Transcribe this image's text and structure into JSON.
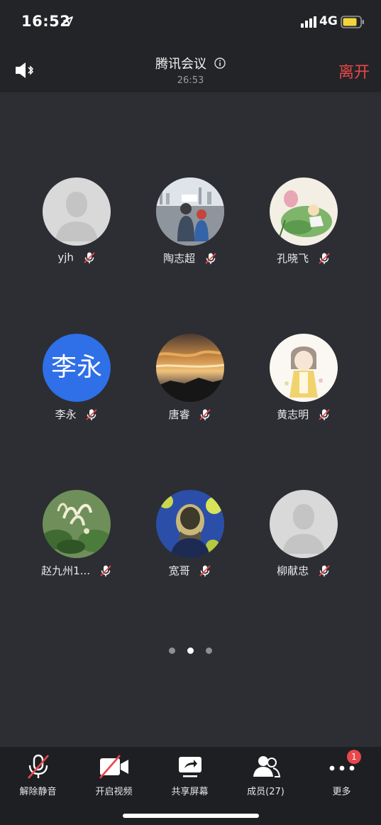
{
  "status_bar": {
    "time": "16:52",
    "network": "4G"
  },
  "header": {
    "title": "腾讯会议",
    "duration": "26:53",
    "leave_label": "离开"
  },
  "participants": [
    {
      "name": "yjh",
      "avatar": "default-person"
    },
    {
      "name": "陶志超",
      "avatar": "photo-two-kids"
    },
    {
      "name": "孔晓飞",
      "avatar": "painting-lotus"
    },
    {
      "name": "李永",
      "avatar": "text",
      "avatar_text": "李永"
    },
    {
      "name": "唐睿",
      "avatar": "photo-sunset-sky"
    },
    {
      "name": "黄志明",
      "avatar": "illustration-girl"
    },
    {
      "name": "赵九州1...",
      "avatar": "photo-flowers"
    },
    {
      "name": "宽哥",
      "avatar": "photo-portrait-blue"
    },
    {
      "name": "柳献忠",
      "avatar": "default-person"
    }
  ],
  "pagination": {
    "pages": 3,
    "active": 2
  },
  "toolbar": {
    "unmute": "解除静音",
    "start_video": "开启视频",
    "share_screen": "共享屏幕",
    "members": "成员(27)",
    "more": "更多",
    "more_badge": "1"
  },
  "colors": {
    "accent_red": "#e8474b",
    "text_avatar_blue": "#2f6fe8",
    "background": "#2c2e33"
  }
}
